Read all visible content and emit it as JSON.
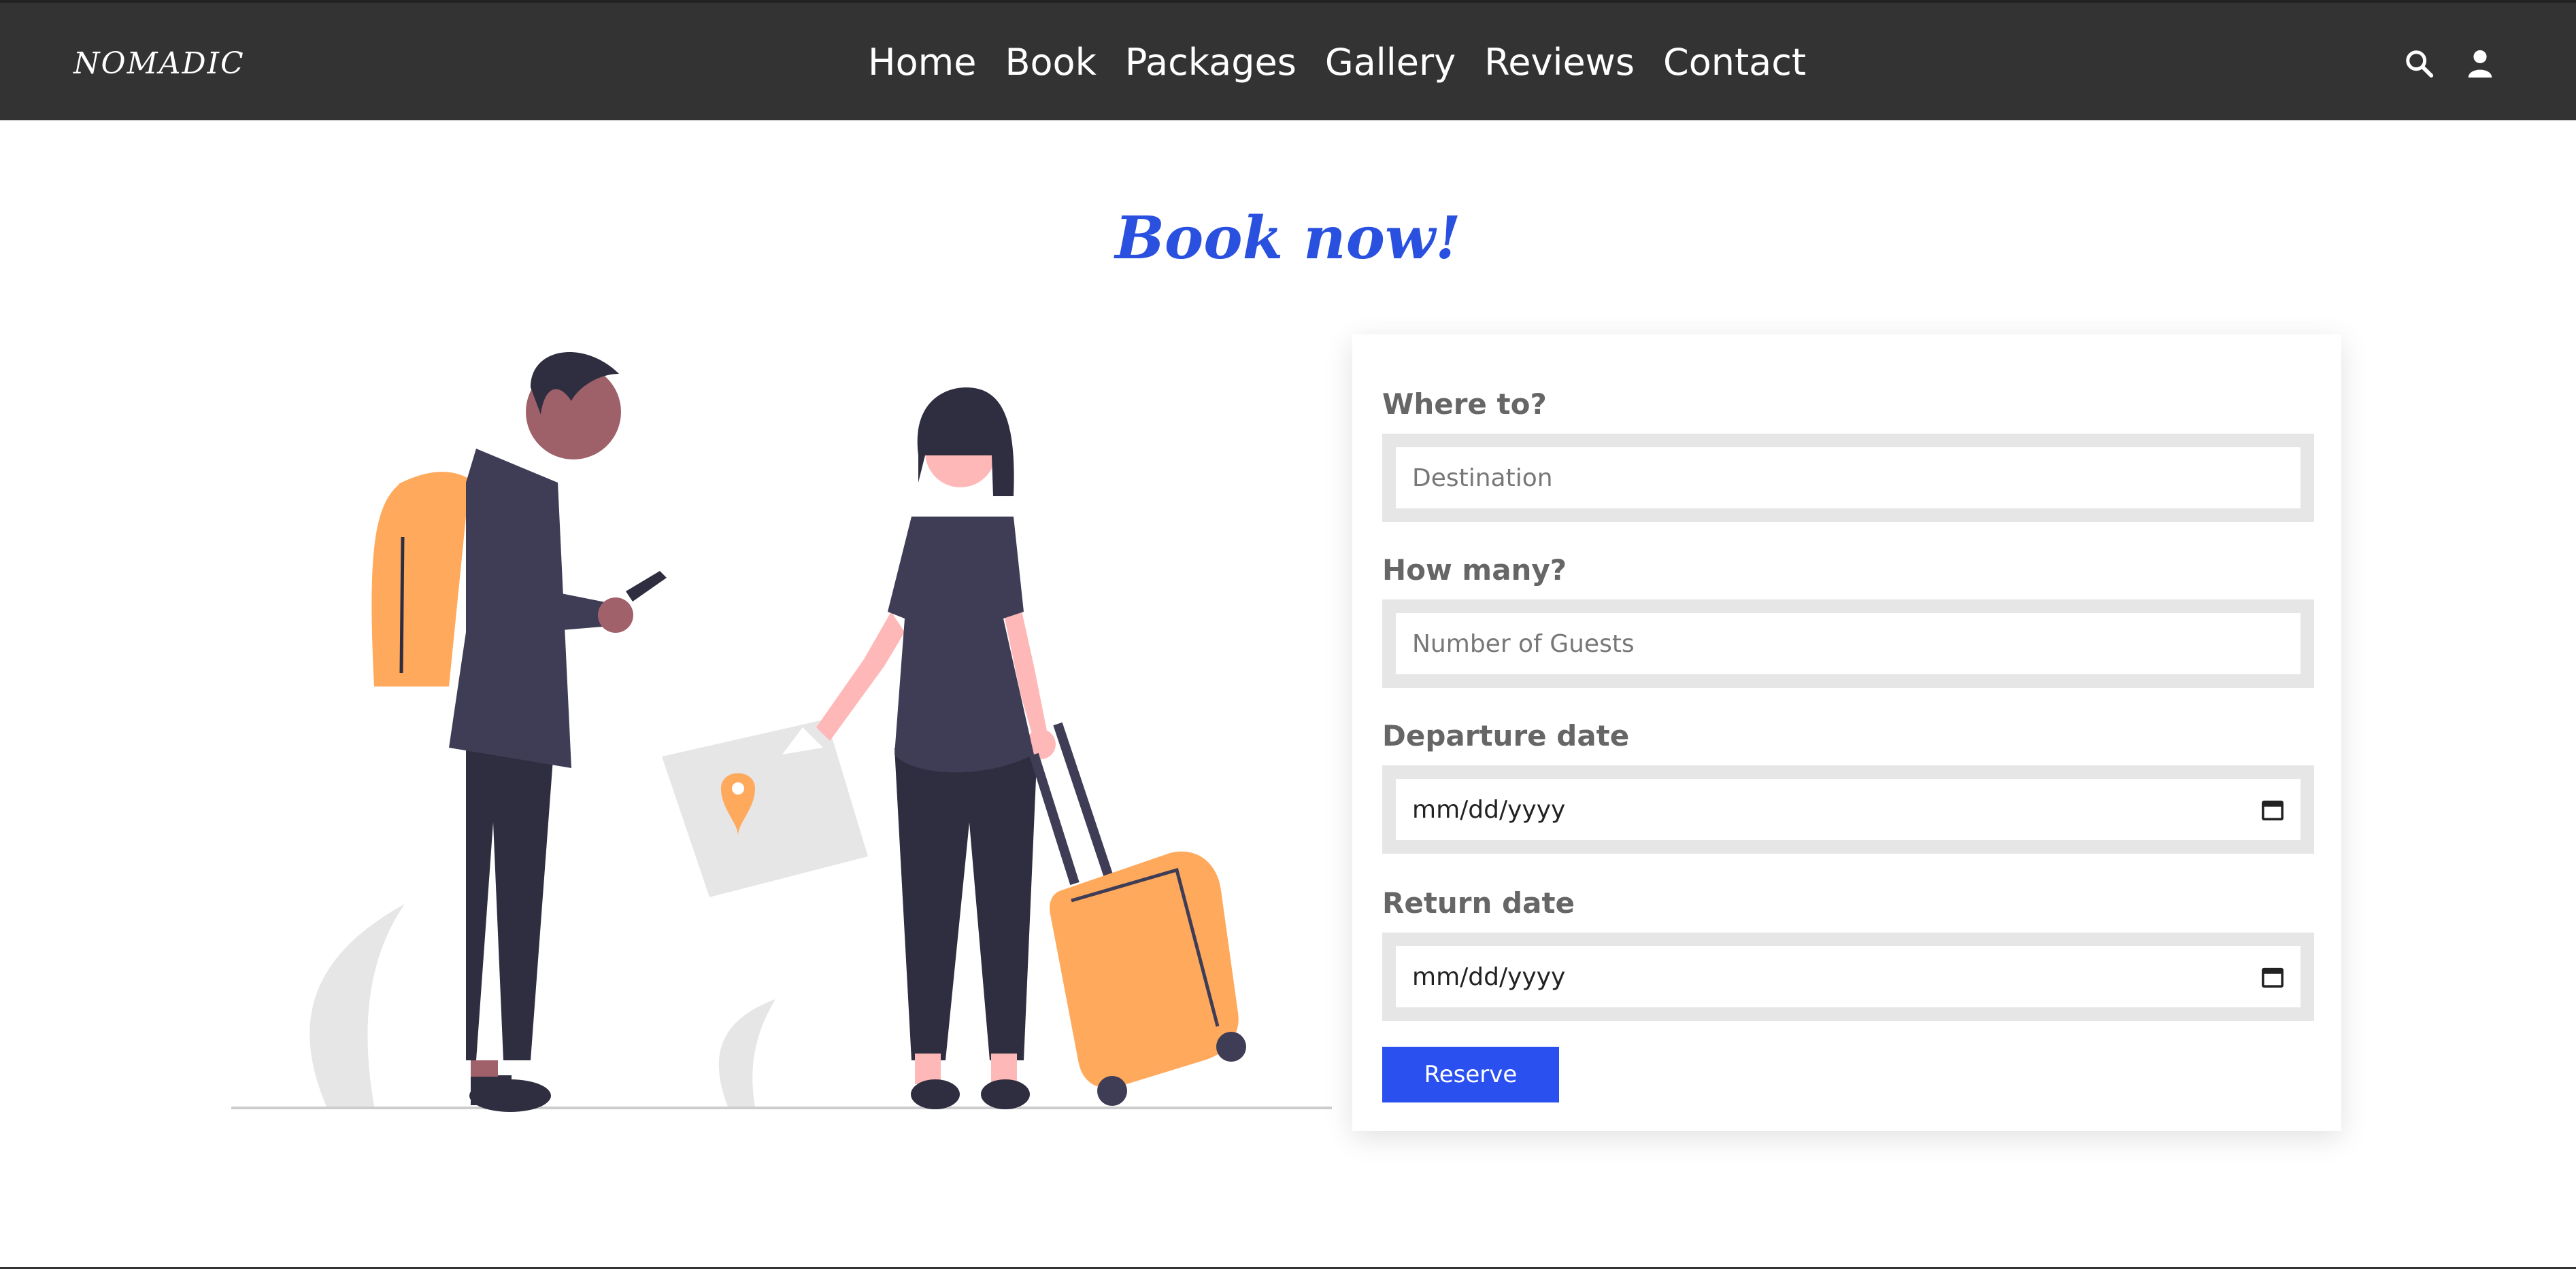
{
  "nav": {
    "logo": "NOMADIC",
    "links": [
      "Home",
      "Book",
      "Packages",
      "Gallery",
      "Reviews",
      "Contact"
    ]
  },
  "icons": {
    "search": "search-icon",
    "user": "user-icon",
    "calendar": "calendar-icon"
  },
  "booking": {
    "heading": "Book now!",
    "fields": [
      {
        "label": "Where to?",
        "placeholder": "Destination"
      },
      {
        "label": "How many?",
        "placeholder": "Number of Guests"
      },
      {
        "label": "Departure date",
        "value": "mm/dd/yyyy"
      },
      {
        "label": "Return date",
        "value": "mm/dd/yyyy"
      }
    ],
    "reserve_label": "Reserve"
  },
  "colors": {
    "nav_bg": "#333333",
    "accent": "#2a50e0",
    "button": "#2a50f0",
    "illustration_orange": "#ffa95c"
  }
}
